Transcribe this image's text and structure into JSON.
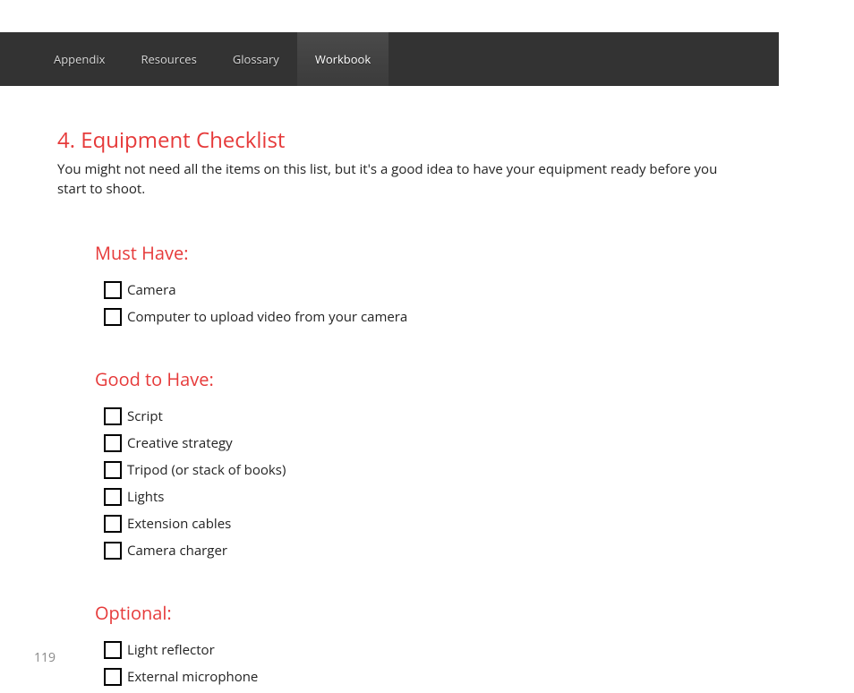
{
  "tabs": [
    {
      "label": "Appendix",
      "active": false
    },
    {
      "label": "Resources",
      "active": false
    },
    {
      "label": "Glossary",
      "active": false
    },
    {
      "label": "Workbook",
      "active": true
    }
  ],
  "title": "4. Equipment Checklist",
  "intro": "You might not need all the items on this list, but it's a good idea to have your equipment ready before you start to shoot.",
  "sections": [
    {
      "heading": "Must Have:",
      "items": [
        "Camera",
        "Computer to upload video from your camera"
      ]
    },
    {
      "heading": "Good to Have:",
      "items": [
        "Script",
        "Creative strategy",
        "Tripod (or stack of books)",
        "Lights",
        "Extension cables",
        "Camera charger"
      ]
    },
    {
      "heading": "Optional:",
      "items": [
        "Light reflector",
        "External microphone"
      ]
    }
  ],
  "page_number": "119"
}
